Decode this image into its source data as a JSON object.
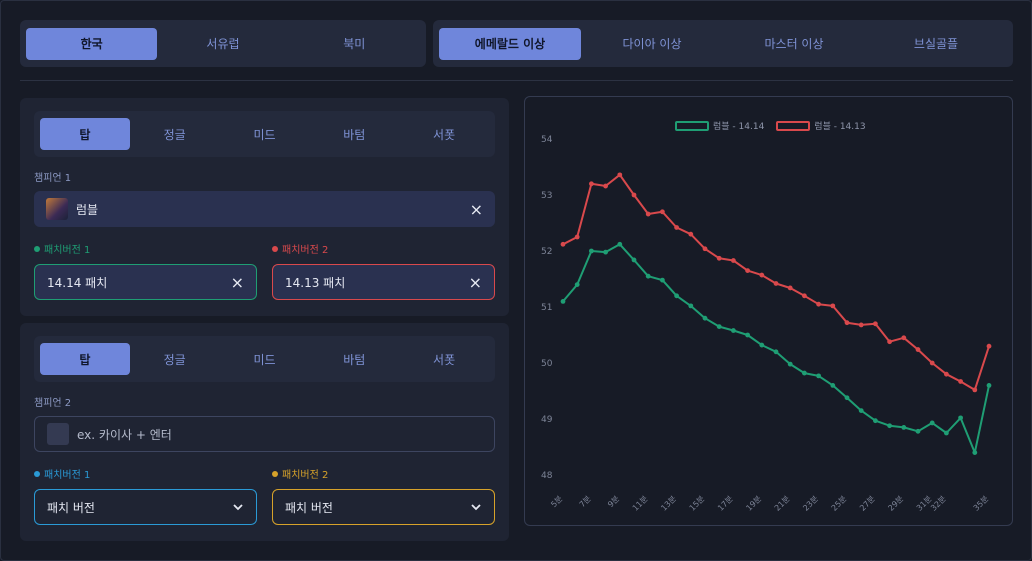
{
  "regions": [
    "한국",
    "서유럽",
    "북미"
  ],
  "region_active": 0,
  "tiers": [
    "에메랄드 이상",
    "다이아 이상",
    "마스터 이상",
    "브실골플"
  ],
  "tier_active": 0,
  "panel1": {
    "roles": [
      "탑",
      "정글",
      "미드",
      "바텀",
      "서폿"
    ],
    "role_active": 0,
    "champ_label": "챔피언 1",
    "champ_value": "럼블",
    "patch1_label": "패치버전 1",
    "patch2_label": "패치버전 2",
    "patch1_value": "14.14 패치",
    "patch2_value": "14.13 패치",
    "clear_icon": "×"
  },
  "panel2": {
    "roles": [
      "탑",
      "정글",
      "미드",
      "바텀",
      "서폿"
    ],
    "role_active": 0,
    "champ_label": "챔피언 2",
    "champ_placeholder": "ex. 카이사 + 엔터",
    "patch1_label": "패치버전 1",
    "patch2_label": "패치버전 2",
    "patch1_value": "패치 버전",
    "patch2_value": "패치 버전"
  },
  "colors": {
    "green": "#1f9e74",
    "red": "#d9494c",
    "blue": "#2a9ad6",
    "gold": "#d6a22a",
    "accent": "#6f86db"
  },
  "chart_data": {
    "type": "line",
    "x": [
      "5분",
      "6분",
      "7분",
      "8분",
      "9분",
      "10분",
      "11분",
      "12분",
      "13분",
      "14분",
      "15분",
      "16분",
      "17분",
      "18분",
      "19분",
      "20분",
      "21분",
      "22분",
      "23분",
      "24분",
      "25분",
      "26분",
      "27분",
      "28분",
      "29분",
      "30분",
      "31분",
      "32분",
      "33분",
      "34분",
      "35분"
    ],
    "x_tick_labels": [
      "5분",
      "7분",
      "9분",
      "11분",
      "13분",
      "15분",
      "17분",
      "19분",
      "21분",
      "23분",
      "25분",
      "27분",
      "29분",
      "31분",
      "32분",
      "35분"
    ],
    "series": [
      {
        "name": "럼블 - 14.14",
        "color": "#1f9e74",
        "values": [
          51.1,
          51.4,
          52.0,
          51.98,
          52.12,
          51.84,
          51.55,
          51.48,
          51.2,
          51.02,
          50.8,
          50.65,
          50.58,
          50.5,
          50.32,
          50.2,
          49.98,
          49.82,
          49.77,
          49.6,
          49.38,
          49.15,
          48.97,
          48.88,
          48.85,
          48.78,
          48.93,
          48.75,
          49.02,
          48.4,
          49.6
        ]
      },
      {
        "name": "럼블 - 14.13",
        "color": "#d9494c",
        "values": [
          52.12,
          52.25,
          53.2,
          53.16,
          53.36,
          53.0,
          52.66,
          52.7,
          52.42,
          52.3,
          52.04,
          51.87,
          51.83,
          51.65,
          51.57,
          51.42,
          51.34,
          51.2,
          51.05,
          51.02,
          50.72,
          50.68,
          50.7,
          50.38,
          50.45,
          50.24,
          50.0,
          49.8,
          49.67,
          49.52,
          50.3
        ]
      }
    ],
    "ylim": [
      48,
      54
    ],
    "y_ticks": [
      48,
      49,
      50,
      51,
      52,
      53,
      54
    ],
    "legend": "top-center"
  }
}
